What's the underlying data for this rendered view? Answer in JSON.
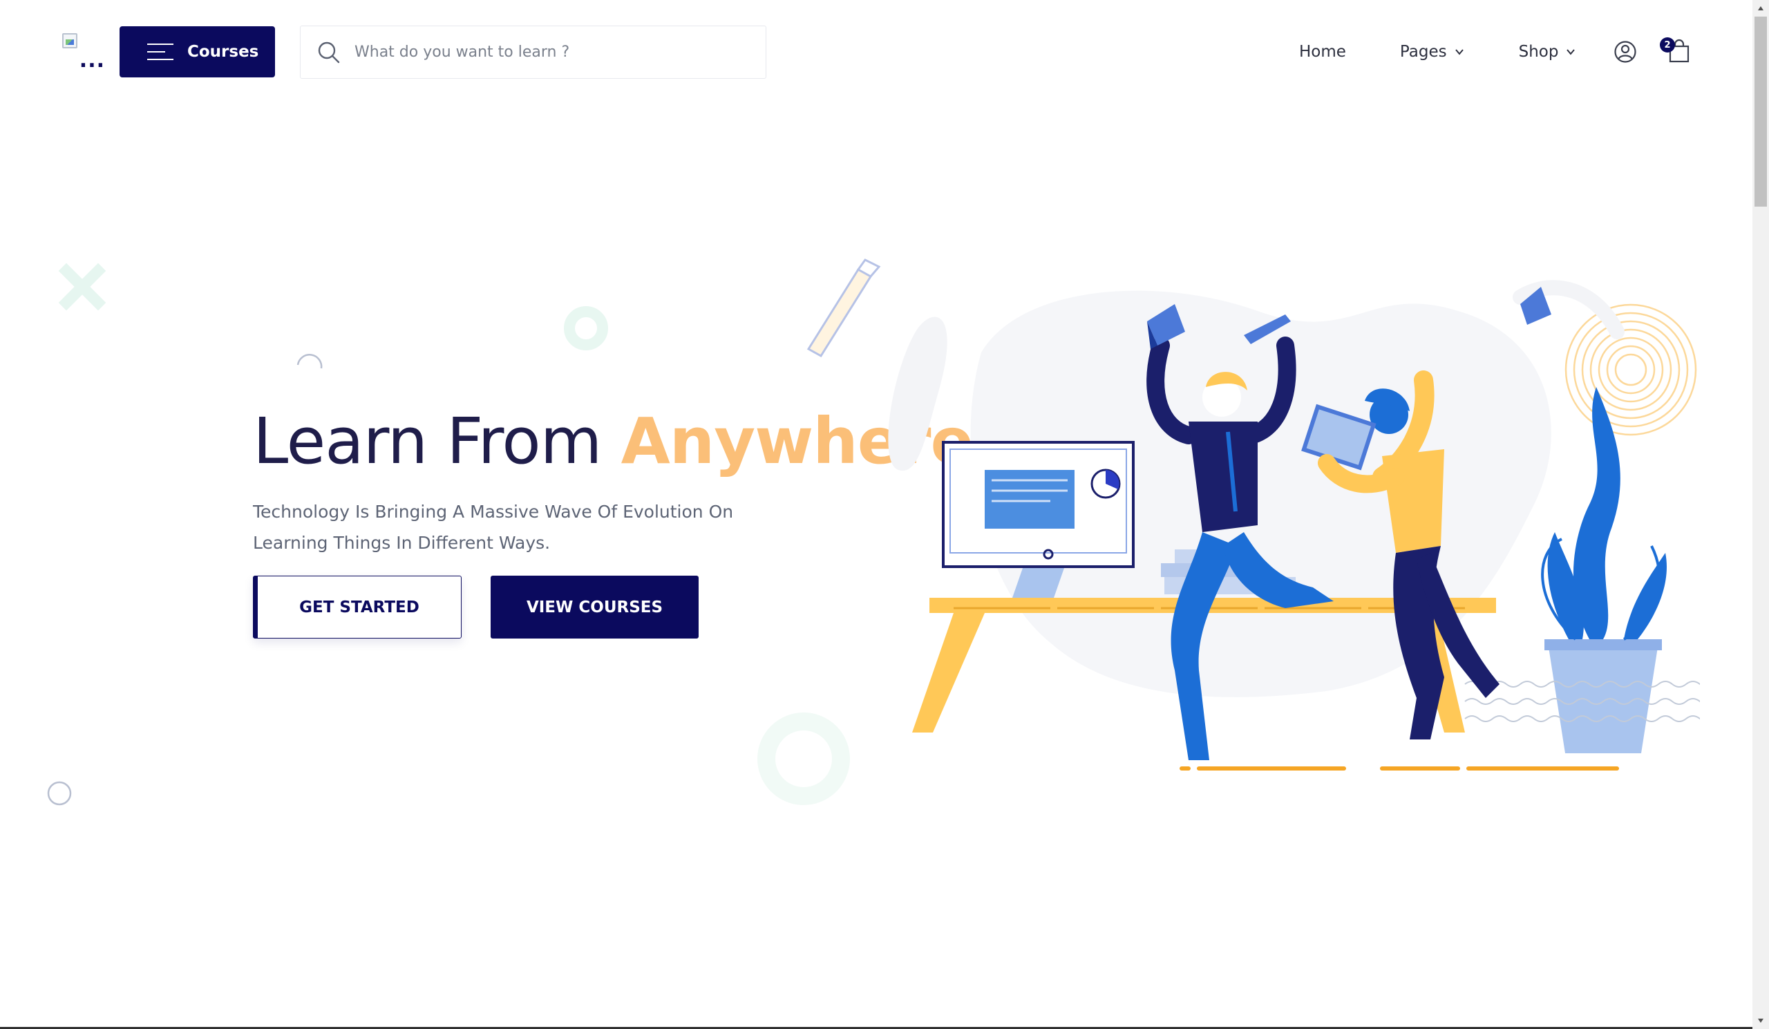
{
  "header": {
    "logo_alt": "...",
    "courses_label": "Courses",
    "search_placeholder": "What do you want to learn ?",
    "nav": {
      "home": "Home",
      "pages": "Pages",
      "shop": "Shop"
    },
    "cart_count": "2"
  },
  "hero": {
    "title_main": "Learn From ",
    "title_accent": "Anywhere",
    "subtitle": "Technology Is Bringing A Massive Wave Of Evolution On Learning Things In Different Ways.",
    "primary_button": "GET STARTED",
    "secondary_button": "VIEW COURSES"
  },
  "colors": {
    "brand": "#0b0a5e",
    "accent": "#fbbf78",
    "yellow": "#ffc857",
    "blue": "#1c6ed6"
  },
  "icons": {
    "menu": "hamburger-icon",
    "search": "search-icon",
    "user": "user-icon",
    "cart": "shopping-bag-icon"
  }
}
